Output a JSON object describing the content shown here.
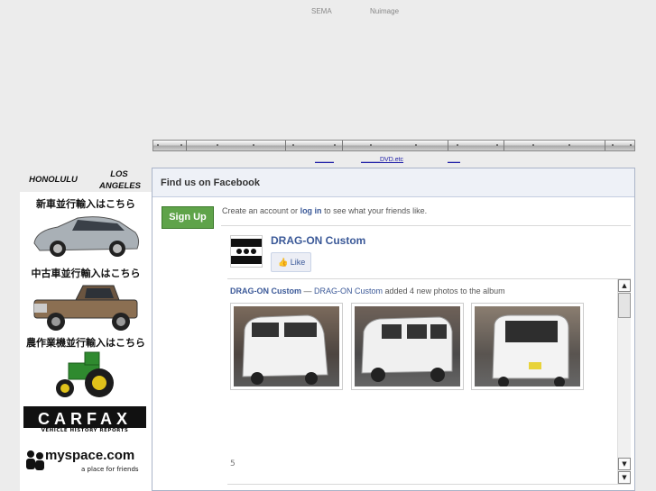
{
  "top_links": {
    "sema": "SEMA",
    "nuimage": "Nuimage"
  },
  "sub_links": {
    "link1": "＿＿＿",
    "link2": "＿＿＿DVD.etc",
    "link3": "＿＿"
  },
  "left": {
    "city_honolulu": "HONOLULU",
    "city_la": "LOS ANGELES",
    "new_car": "新車並行輸入はこちら",
    "used_car": "中古車並行輸入はこちら",
    "farm": "農作業機並行輸入はこちら",
    "carfax": "CARFAX",
    "carfax_sub": "VEHICLE HISTORY REPORTS",
    "myspace": "myspace.com",
    "myspace_tag": "a place for friends"
  },
  "facebook": {
    "header": "Find us on Facebook",
    "signup": "Sign Up",
    "create_text_pre": "Create an account or ",
    "login": "log in",
    "create_text_post": " to see what your friends like.",
    "page_name": "DRAG-ON  Custom",
    "like": "Like",
    "post_author": "DRAG-ON  Custom",
    "post_sep": " — ",
    "post_link": "DRAG-ON Custom",
    "post_text": " added 4 new photos to the album",
    "count": "5"
  },
  "colors": {
    "fb_blue": "#3b5998",
    "signup_green": "#5fa34a"
  }
}
